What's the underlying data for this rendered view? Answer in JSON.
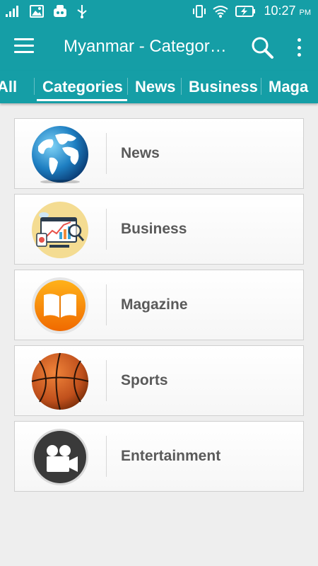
{
  "status_bar": {
    "time": "10:27",
    "ampm": "PM"
  },
  "app_bar": {
    "title": "Myanmar - Categor…"
  },
  "tabs": [
    {
      "label": "All"
    },
    {
      "label": "Categories",
      "selected": true
    },
    {
      "label": "News"
    },
    {
      "label": "Business"
    },
    {
      "label": "Maga"
    }
  ],
  "categories": [
    {
      "label": "News",
      "icon": "globe-icon"
    },
    {
      "label": "Business",
      "icon": "business-chart-icon"
    },
    {
      "label": "Magazine",
      "icon": "book-icon"
    },
    {
      "label": "Sports",
      "icon": "basketball-icon"
    },
    {
      "label": "Entertainment",
      "icon": "video-camera-icon"
    }
  ],
  "colors": {
    "primary": "#159ea6",
    "background": "#eeeeee",
    "label": "#5a5a5a"
  }
}
